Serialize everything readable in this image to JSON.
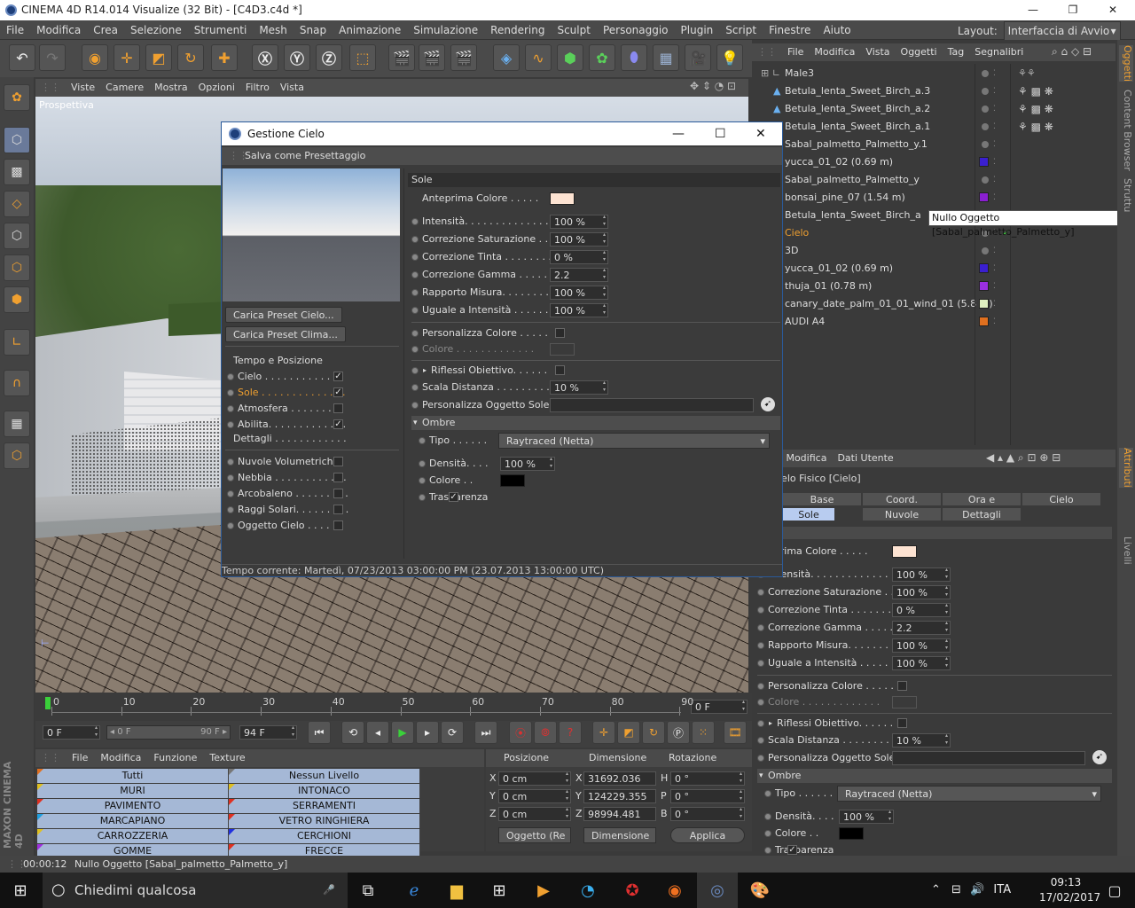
{
  "window": {
    "title": "CINEMA 4D R14.014 Visualize (32 Bit) - [C4D3.c4d *]",
    "min": "—",
    "max": "❐",
    "close": "✕"
  },
  "menu": [
    "File",
    "Modifica",
    "Crea",
    "Selezione",
    "Strumenti",
    "Mesh",
    "Snap",
    "Animazione",
    "Simulazione",
    "Rendering",
    "Sculpt",
    "Personaggio",
    "Plugin",
    "Script",
    "Finestre",
    "Aiuto"
  ],
  "layout": {
    "label": "Layout:",
    "value": "Interfaccia di Avvio"
  },
  "viewport": {
    "menu": [
      "Viste",
      "Camere",
      "Mostra",
      "Opzioni",
      "Filtro",
      "Vista"
    ],
    "label": "Prospettiva"
  },
  "timeline": {
    "ticks": [
      "0",
      "10",
      "20",
      "30",
      "40",
      "50",
      "60",
      "70",
      "80",
      "90"
    ],
    "frame": "0 F"
  },
  "playbar": {
    "start": "0 F",
    "range_left": "◂ 0 F",
    "range_right": "90 F ▸",
    "end": "94 F"
  },
  "materials": {
    "menu": [
      "File",
      "Modifica",
      "Funzione",
      "Texture"
    ],
    "left": [
      "Tutti",
      "MURI",
      "PAVIMENTO",
      "MARCAPIANO",
      "CARROZZERIA",
      "GOMME"
    ],
    "right": [
      "Nessun Livello",
      "INTONACO",
      "SERRAMENTI",
      "VETRO RINGHIERA",
      "CERCHIONI",
      "FRECCE"
    ]
  },
  "coords": {
    "headers": [
      "Posizione",
      "Dimensione",
      "Rotazione"
    ],
    "rows": [
      {
        "axis": "X",
        "pos": "0 cm",
        "dlab": "X",
        "dim": "31692.036 cm",
        "rlab": "H",
        "rot": "0 °"
      },
      {
        "axis": "Y",
        "pos": "0 cm",
        "dlab": "Y",
        "dim": "124229.355 cı",
        "rlab": "P",
        "rot": "0 °"
      },
      {
        "axis": "Z",
        "pos": "0 cm",
        "dlab": "Z",
        "dim": "98994.481 cm",
        "rlab": "B",
        "rot": "0 °"
      }
    ],
    "mode1": "Oggetto (Re",
    "mode2": "Dimensione",
    "apply": "Applica"
  },
  "objects": {
    "menu": [
      "File",
      "Modifica",
      "Vista",
      "Oggetti",
      "Tag",
      "Segnalibri"
    ],
    "items": [
      {
        "name": "Male3",
        "color": ""
      },
      {
        "name": "Betula_lenta_Sweet_Birch_a.3",
        "color": ""
      },
      {
        "name": "Betula_lenta_Sweet_Birch_a.2",
        "color": ""
      },
      {
        "name": "Betula_lenta_Sweet_Birch_a.1",
        "color": ""
      },
      {
        "name": "Sabal_palmetto_Palmetto_y.1",
        "color": ""
      },
      {
        "name": "yucca_01_02 (0.69 m)",
        "color": "#3a1fd0"
      },
      {
        "name": "Sabal_palmetto_Palmetto_y",
        "color": ""
      },
      {
        "name": "bonsai_pine_07 (1.54 m)",
        "color": "#8a1fd0"
      },
      {
        "name": "Betula_lenta_Sweet_Birch_a",
        "color": ""
      },
      {
        "name": "Cielo",
        "color": ""
      },
      {
        "name": "3D",
        "color": ""
      },
      {
        "name": "yucca_01_02 (0.69 m)",
        "color": "#3a1fd0"
      },
      {
        "name": "thuja_01 (0.78 m)",
        "color": "#9a2fe0"
      },
      {
        "name": "canary_date_palm_01_01_wind_01 (5.8 m)",
        "color": "#e0f0c0"
      },
      {
        "name": "AUDI A4",
        "color": "#e0701f"
      }
    ],
    "tooltip": "Nullo Oggetto [Sabal_palmetto_Palmetto_y]"
  },
  "side_tabs": [
    "Oggetti",
    "Content Browser",
    "Struttu",
    "Attributi",
    "Livelli"
  ],
  "attributes": {
    "menu": [
      "odo",
      "Modifica",
      "Dati Utente"
    ],
    "object": "ielo Fisico [Cielo]",
    "tabs_row1": [
      "Base",
      "Coord.",
      "Ora e Locazione",
      "Cielo"
    ],
    "tabs_row2": [
      "Sole",
      "Nuvole",
      "Dettagli"
    ],
    "preview_label": "eprima Colore . . . . .",
    "props": [
      {
        "label": "Intensità. . . . . . . . . . . . .",
        "value": "100 %"
      },
      {
        "label": "Correzione Saturazione . .",
        "value": "100 %"
      },
      {
        "label": "Correzione Tinta . . . . . . . .",
        "value": "0 %"
      },
      {
        "label": "Correzione Gamma . . . . .",
        "value": "2.2"
      },
      {
        "label": "Rapporto Misura. . . . . . . .",
        "value": "100 %"
      },
      {
        "label": "Uguale a Intensità . . . . . .",
        "value": "100 %"
      }
    ],
    "custom_color": "Personalizza Colore . . . . .",
    "color": "Colore . . . . . . . . . . . . .",
    "lens": "Riflessi Obiettivo. . . . . .",
    "scale": "Scala Distanza . . . . . . . . .",
    "scale_value": "10 %",
    "sun_obj": "Personalizza Oggetto Sole",
    "shadow": "Ombre",
    "type_label": "Tipo . . . . . .",
    "type_value": "Raytraced (Netta)",
    "density_label": "Densità. . . .",
    "density_value": "100 %",
    "scolor": "Colore . .",
    "transp": "Trasparenza"
  },
  "dialog": {
    "title": "Gestione Cielo",
    "sub": "Salva come Presettaggio",
    "btn1": "Carica Preset Cielo...",
    "btn2": "Carica Preset Clima...",
    "section": "Tempo e Posizione",
    "checks": [
      {
        "label": "Cielo . . . . . . . . . . . . .",
        "checked": "✓"
      },
      {
        "label": "Sole . . . . . . . . . . . . . .",
        "checked": "✓"
      },
      {
        "label": "Atmosfera . . . . . . . . .",
        "checked": ""
      },
      {
        "label": "Abilita. . . . . . . . . . . . .",
        "checked": "✓"
      }
    ],
    "details": "Dettagli . . . . . . . . . . . .",
    "checks2": [
      {
        "label": "Nuvole Volumetriche",
        "checked": ""
      },
      {
        "label": "Nebbia . . . . . . . . . . . .",
        "checked": ""
      },
      {
        "label": "Arcobaleno . . . . . . . . .",
        "checked": ""
      },
      {
        "label": "Raggi Solari. . . . . . . . .",
        "checked": ""
      },
      {
        "label": "Oggetto Cielo . . . . .",
        "checked": ""
      }
    ],
    "sole_header": "Sole",
    "preview_label": "Anteprima Colore . . . . .",
    "props": [
      {
        "label": "Intensità. . . . . . . . . . . . . . .",
        "value": "100 %"
      },
      {
        "label": "Correzione Saturazione . .",
        "value": "100 %"
      },
      {
        "label": "Correzione Tinta . . . . . . . .",
        "value": "0 %"
      },
      {
        "label": "Correzione Gamma . . . . .",
        "value": "2.2"
      },
      {
        "label": "Rapporto Misura. . . . . . . .",
        "value": "100 %"
      },
      {
        "label": "Uguale a Intensità . . . . . .",
        "value": "100 %"
      }
    ],
    "custom_color": "Personalizza Colore . . . . .",
    "color": "Colore . . . . . . . . . . . . .",
    "lens": "Riflessi Obiettivo. . . . . .",
    "scale": "Scala Distanza . . . . . . . . .",
    "scale_value": "10 %",
    "sun_obj": "Personalizza Oggetto Sole",
    "shadow": "Ombre",
    "type_label": "Tipo . . . . . .",
    "type_value": "Raytraced (Netta)",
    "density_label": "Densità. . . .",
    "density_value": "100 %",
    "scolor": "Colore . .",
    "transp": "Trasparenza",
    "status": "Tempo corrente: Martedì, 07/23/2013 03:00:00 PM (23.07.2013 13:00:00 UTC)"
  },
  "status": {
    "time": "00:00:12",
    "text": "Nullo Oggetto [Sabal_palmetto_Palmetto_y]"
  },
  "taskbar": {
    "search": "Chiedimi qualcosa",
    "lang": "ITA",
    "time": "09:13",
    "date": "17/02/2017"
  },
  "brand": "MAXON CINEMA 4D",
  "colors": {
    "accent": "#f0a030",
    "preview_swatch": "#fde3d2"
  }
}
